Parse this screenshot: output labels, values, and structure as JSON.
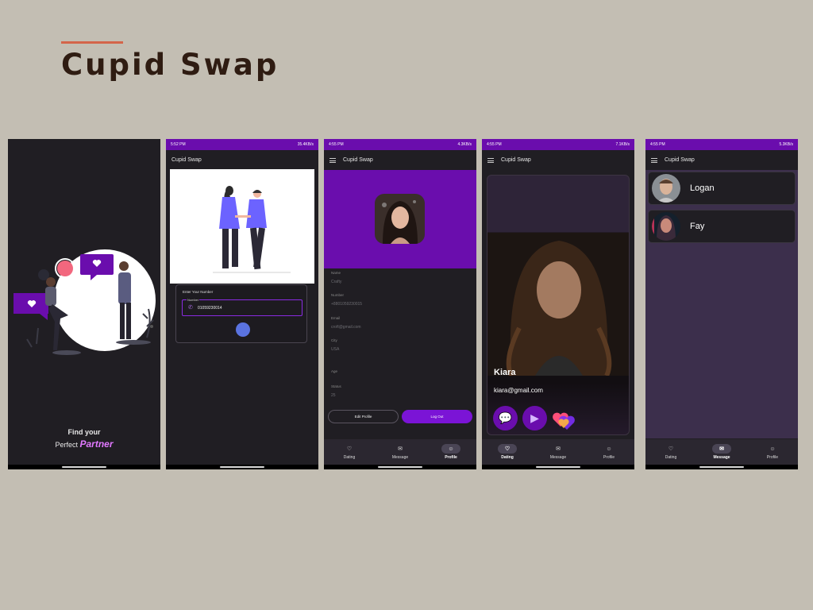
{
  "header": {
    "title": "Cupid Swap"
  },
  "screens": {
    "splash": {
      "line1": "Find your",
      "line2": "Perfect",
      "highlight": "Partner"
    },
    "login": {
      "status_time": "5:52 PM",
      "status_net": "35.4KB/s",
      "app_title": "Cupid Swap",
      "card_label": "Enter Your Number",
      "field_label": "Number",
      "field_value": "01059230014"
    },
    "profile": {
      "status_time": "4:55 PM",
      "status_net": "4.3KB/s",
      "app_title": "Cupid Swap",
      "fields": [
        {
          "label": "Name",
          "value": "Crafty"
        },
        {
          "label": "Number",
          "value": "+8801059230015"
        },
        {
          "label": "Email",
          "value": "croft@gmail.com"
        },
        {
          "label": "City",
          "value": "USA"
        },
        {
          "label": "Age",
          "value": ""
        },
        {
          "label": "Status",
          "value": "25"
        }
      ],
      "edit_label": "Edit Profile",
      "logout_label": "Log Out"
    },
    "dating": {
      "status_time": "4:55 PM",
      "status_net": "7.1KB/s",
      "app_title": "Cupid Swap",
      "name": "Kiara",
      "email": "kiara@gmail.com"
    },
    "messages": {
      "status_time": "4:55 PM",
      "status_net": "5.3KB/s",
      "app_title": "Cupid Swap",
      "contacts": [
        "Logan",
        "Fay"
      ]
    }
  },
  "nav": {
    "dating": "Dating",
    "message": "Message",
    "profile": "Profile"
  },
  "colors": {
    "primary": "#6a0dad",
    "accent": "#d4654a",
    "background": "#c3beb3",
    "dark": "#201e23"
  }
}
